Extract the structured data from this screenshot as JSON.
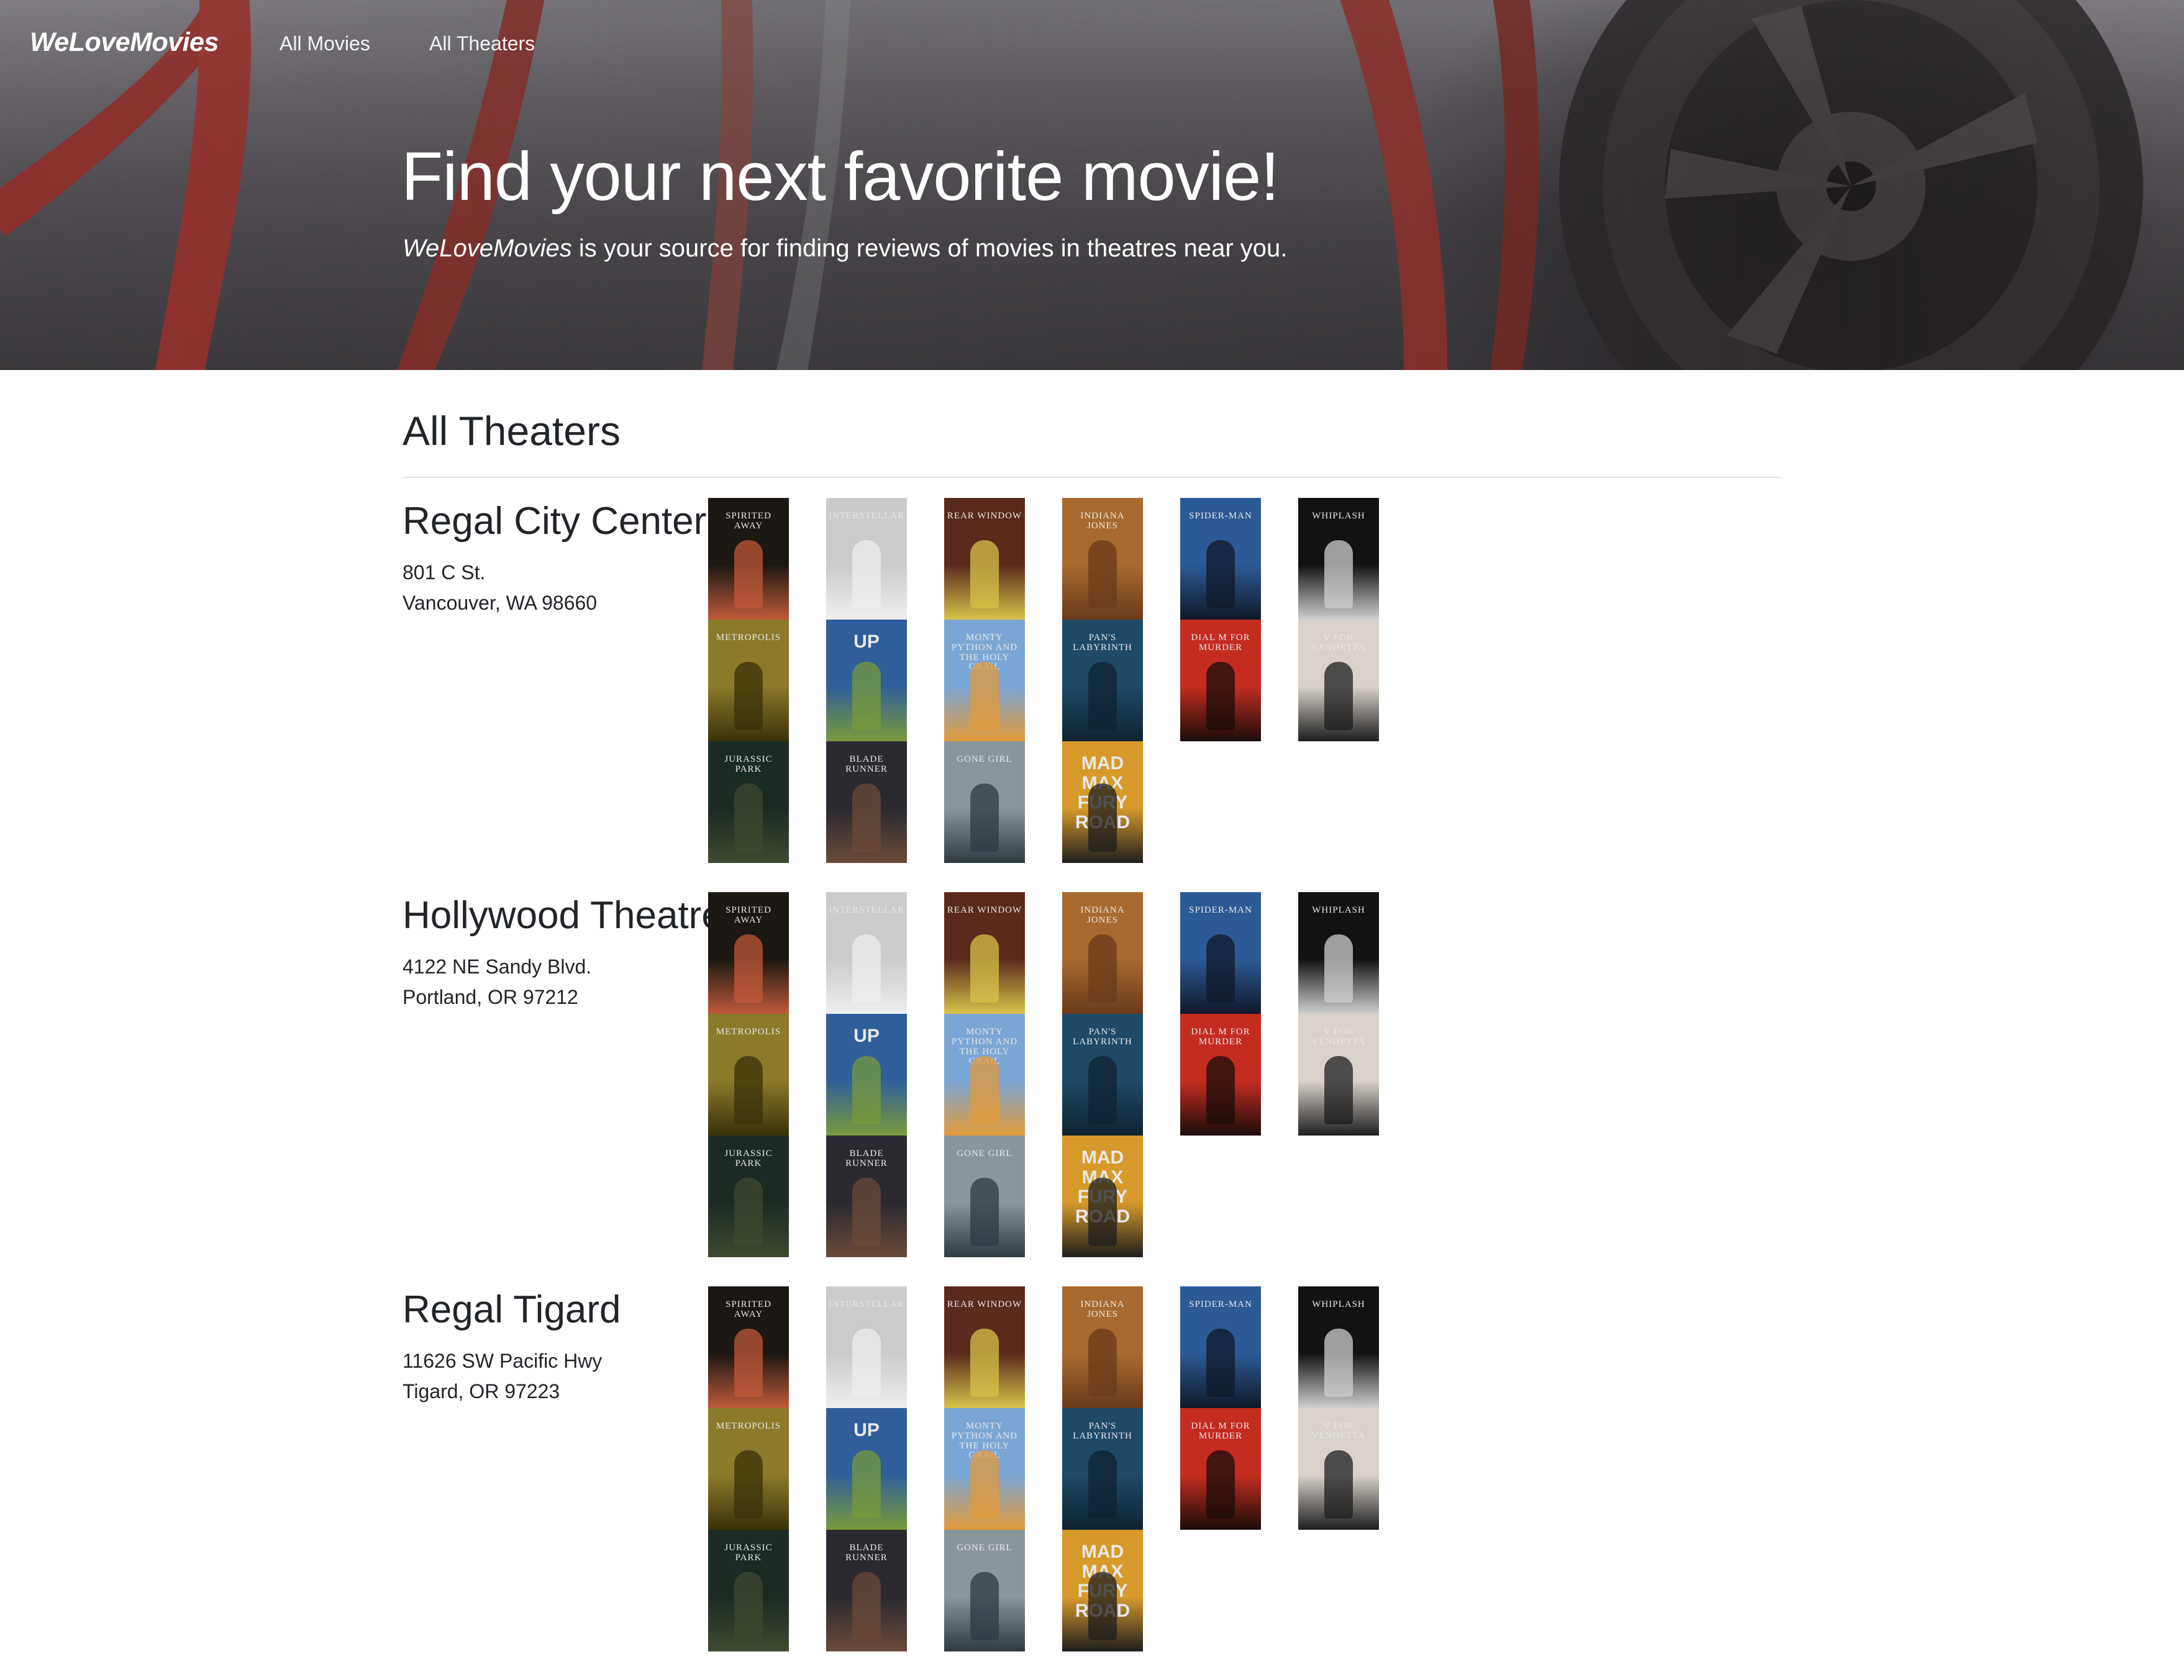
{
  "nav": {
    "brand": "WeLoveMovies",
    "links": [
      "All Movies",
      "All Theaters"
    ]
  },
  "hero": {
    "title": "Find your next favorite movie!",
    "subtitle_brand": "WeLoveMovies",
    "subtitle_rest": " is your source for finding reviews of movies in theatres near you."
  },
  "page": {
    "heading": "All Theaters"
  },
  "theaters": [
    {
      "name": "Regal City Center",
      "address_line1": "801 C St.",
      "address_line2": "Vancouver, WA 98660"
    },
    {
      "name": "Hollywood Theatre",
      "address_line1": "4122 NE Sandy Blvd.",
      "address_line2": "Portland, OR 97212"
    },
    {
      "name": "Regal Tigard",
      "address_line1": "11626 SW Pacific Hwy",
      "address_line2": "Tigard, OR 97223"
    }
  ],
  "posters": [
    {
      "title": "SPIRITED AWAY",
      "bg": "#1b1712",
      "fg": "#c05a3a",
      "style": "serif"
    },
    {
      "title": "INTERSTELLAR",
      "bg": "#c9cbcc",
      "fg": "#eeeeee",
      "style": "serif"
    },
    {
      "title": "REAR WINDOW",
      "bg": "#5b2a1c",
      "fg": "#d8c24a",
      "style": "serif"
    },
    {
      "title": "INDIANA JONES",
      "bg": "#a86a2e",
      "fg": "#6b3a1a",
      "style": "serif"
    },
    {
      "title": "SPIDER-MAN",
      "bg": "#2c5a96",
      "fg": "#101827",
      "style": "serif"
    },
    {
      "title": "WHIPLASH",
      "bg": "#121212",
      "fg": "#cfcfcf",
      "style": "serif"
    },
    {
      "title": "METROPOLIS",
      "bg": "#8a7a2a",
      "fg": "#3a3208",
      "style": "serif"
    },
    {
      "title": "UP",
      "bg": "#2f5f9a",
      "fg": "#7a9a3a",
      "style": "big"
    },
    {
      "title": "MONTY PYTHON AND THE HOLY GRAIL",
      "bg": "#7aa6d6",
      "fg": "#e39a3a",
      "style": "serif"
    },
    {
      "title": "PAN'S LABYRINTH",
      "bg": "#1e4a66",
      "fg": "#0f2230",
      "style": "serif"
    },
    {
      "title": "DIAL M FOR MURDER",
      "bg": "#c42c20",
      "fg": "#1a0c0a",
      "style": "serif"
    },
    {
      "title": "V FOR VENDETTA",
      "bg": "#d8d2ca",
      "fg": "#1e1e1e",
      "style": "serif"
    },
    {
      "title": "JURASSIC PARK",
      "bg": "#1c2a24",
      "fg": "#3e4a30",
      "style": "serif"
    },
    {
      "title": "BLADE RUNNER",
      "bg": "#2a2a30",
      "fg": "#6a4a3a",
      "style": "serif"
    },
    {
      "title": "GONE GIRL",
      "bg": "#8a969a",
      "fg": "#2e3a40",
      "style": "serif"
    },
    {
      "title": "MAD MAX FURY ROAD",
      "bg": "#d79a2a",
      "fg": "#1e1e1e",
      "style": "big"
    }
  ]
}
